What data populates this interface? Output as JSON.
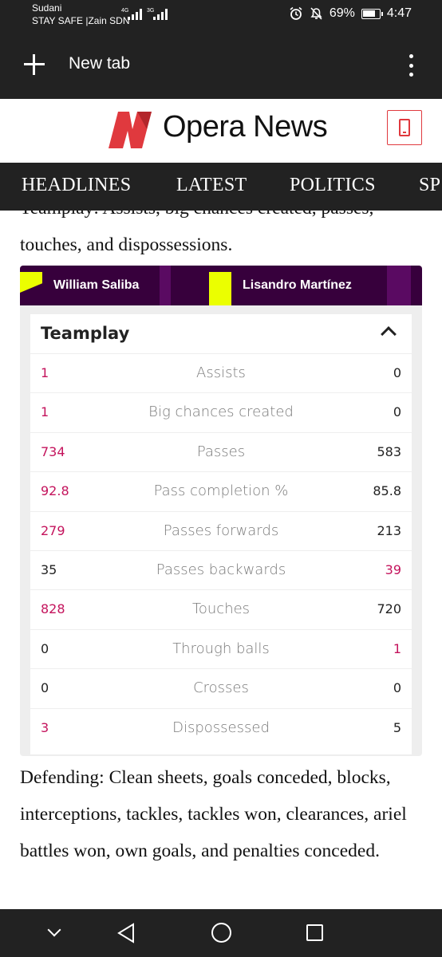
{
  "status_bar": {
    "carrier_top": "Sudani",
    "carrier_bottom": "STAY SAFE |Zain SDN",
    "signal1_type": "4G",
    "signal2_type": "3G",
    "battery": "69%",
    "time": "4:47"
  },
  "browser": {
    "tab_title": "New tab"
  },
  "site": {
    "brand": "Opera News",
    "logo_color": "#e0393e"
  },
  "nav": {
    "items": [
      "HEADLINES",
      "LATEST",
      "POLITICS",
      "SP"
    ]
  },
  "article": {
    "para_top": "Teamplay: Assists, big chances created, passes, touches, and dispossessions.",
    "para_bottom": "Defending: Clean sheets, goals conceded, blocks, interceptions, tackles, tackles won, clearances, ariel battles won, own goals, and penalties conceded."
  },
  "comparison": {
    "player_left": "William Saliba",
    "player_right": "Lisandro Martínez",
    "section_title": "Teamplay",
    "accent": "#c4135c",
    "header_bg": "#37003c",
    "highlight": "#ebff00",
    "rows": [
      {
        "left": "1",
        "label": "Assists",
        "right": "0",
        "lead": "left"
      },
      {
        "left": "1",
        "label": "Big chances created",
        "right": "0",
        "lead": "left"
      },
      {
        "left": "734",
        "label": "Passes",
        "right": "583",
        "lead": "left"
      },
      {
        "left": "92.8",
        "label": "Pass completion %",
        "right": "85.8",
        "lead": "left"
      },
      {
        "left": "279",
        "label": "Passes forwards",
        "right": "213",
        "lead": "left"
      },
      {
        "left": "35",
        "label": "Passes backwards",
        "right": "39",
        "lead": "right"
      },
      {
        "left": "828",
        "label": "Touches",
        "right": "720",
        "lead": "left"
      },
      {
        "left": "0",
        "label": "Through balls",
        "right": "1",
        "lead": "right"
      },
      {
        "left": "0",
        "label": "Crosses",
        "right": "0",
        "lead": "none"
      },
      {
        "left": "3",
        "label": "Dispossessed",
        "right": "5",
        "lead": "left"
      }
    ]
  }
}
